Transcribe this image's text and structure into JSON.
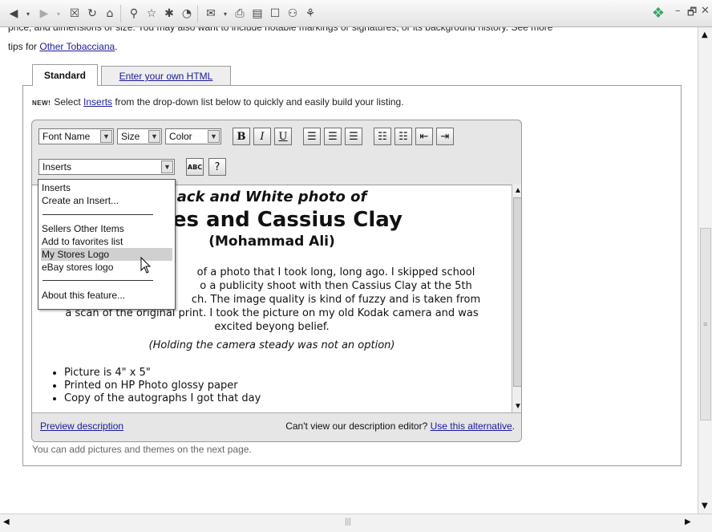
{
  "intro": {
    "clipped_line": "price, and dimensions or size. You may also want to include notable markings or signatures, or its background history. See more",
    "line2_prefix": "tips for ",
    "line2_link": "Other Tobacciana",
    "line2_suffix": "."
  },
  "tabs": [
    {
      "label": "Standard"
    },
    {
      "label": "Enter your own HTML"
    }
  ],
  "new_notice": {
    "badge": "NEW!",
    "prefix": "Select ",
    "link": "Inserts",
    "suffix": " from the drop-down list below to quickly and easily build your listing."
  },
  "toolbar": {
    "font_name": "Font Name",
    "size": "Size",
    "color": "Color",
    "bold": "B",
    "italic": "I",
    "underline": "U",
    "inserts_selected": "Inserts",
    "spell_label": "ABC",
    "help_label": "?"
  },
  "dropdown": {
    "items": [
      "Inserts",
      "Create an Insert...",
      "Sellers Other Items",
      "Add to favorites list",
      "My Stores Logo",
      "eBay stores logo",
      "About this feature..."
    ],
    "highlighted": "My Stores Logo"
  },
  "document": {
    "title1": "ack and White photo of",
    "title2": "atles and Cassius Clay",
    "title3": "(Mohammad Ali)",
    "para_lines": [
      "of a photo that I took long, long ago. I skipped school",
      "o a publicity shoot with then Cassius Clay at the 5th",
      "ch. The image quality is kind of fuzzy and is taken from",
      "a scan of the original print. I took the picture on my old Kodak camera and was",
      "excited beyong belief."
    ],
    "italic_line": "(Holding the camera steady was not an option)",
    "bullets": [
      "Picture is 4\" x 5\"",
      "Printed on HP Photo glossy paper",
      "Copy of the autographs I got that day"
    ]
  },
  "editor_footer": {
    "preview_link": "Preview description",
    "cant_view": "Can't view our description editor? ",
    "alternative_link": "Use this alternative",
    "alt_suffix": "."
  },
  "below_note": "You can add pictures and themes on the next page.",
  "window": {
    "minimize": "–",
    "restore": "🗗",
    "close": "✕"
  },
  "colors": {
    "link": "#1a1a9a",
    "highlight": "#d0d0d0"
  }
}
